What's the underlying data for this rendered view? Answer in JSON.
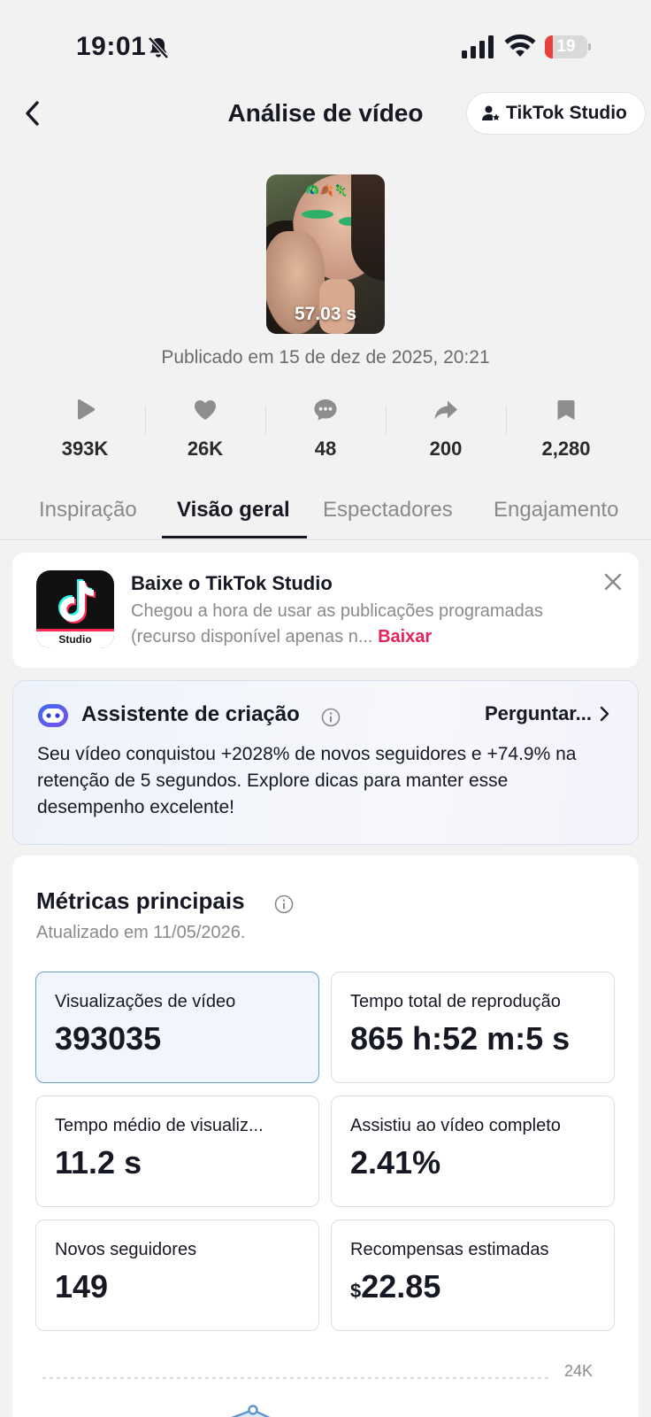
{
  "status_bar": {
    "time": "19:01",
    "battery": "19",
    "battery_level": 0.19
  },
  "header": {
    "title": "Análise de vídeo",
    "studio_button": "TikTok Studio"
  },
  "video": {
    "duration": "57.03 s",
    "emoji": "🦚🍂🦎",
    "published": "Publicado em 15 de dez de 2025, 20:21"
  },
  "stats": [
    {
      "icon": "play-icon",
      "value": "393K"
    },
    {
      "icon": "heart-icon",
      "value": "26K"
    },
    {
      "icon": "comment-icon",
      "value": "48"
    },
    {
      "icon": "share-icon",
      "value": "200"
    },
    {
      "icon": "bookmark-icon",
      "value": "2,280"
    }
  ],
  "tabs": [
    {
      "label": "Inspiração"
    },
    {
      "label": "Visão geral",
      "active": true
    },
    {
      "label": "Espectadores"
    },
    {
      "label": "Engajamento"
    }
  ],
  "promo": {
    "title": "Baixe o TikTok Studio",
    "text": "Chegou a hora de usar as publicações programadas (recurso disponível apenas n...",
    "link": "Baixar",
    "app_badge": "Studio"
  },
  "assistant": {
    "title": "Assistente de criação",
    "ask": "Perguntar...",
    "text": "Seu vídeo conquistou +2028% de novos seguidores e +74.9% na retenção de 5 segundos. Explore dicas para manter esse desempenho excelente!"
  },
  "metrics": {
    "title": "Métricas principais",
    "updated": "Atualizado em 11/05/2026.",
    "items": [
      {
        "label": "Visualizações de vídeo",
        "value": "393035",
        "selected": true
      },
      {
        "label": "Tempo total de reprodução",
        "value": "865 h:52 m:5 s"
      },
      {
        "label": "Tempo médio de visualiz...",
        "value": "11.2 s"
      },
      {
        "label": "Assistiu ao vídeo completo",
        "value": "2.41%"
      },
      {
        "label": "Novos seguidores",
        "value": "149"
      },
      {
        "label": "Recompensas estimadas",
        "currency": "$",
        "value": "22.85"
      }
    ],
    "chart_max_label": "24K"
  },
  "colors": {
    "accent": "#fe2c55",
    "link": "#e3245a",
    "selected_border": "#6a9ed4",
    "chart": "#5b93d1"
  }
}
